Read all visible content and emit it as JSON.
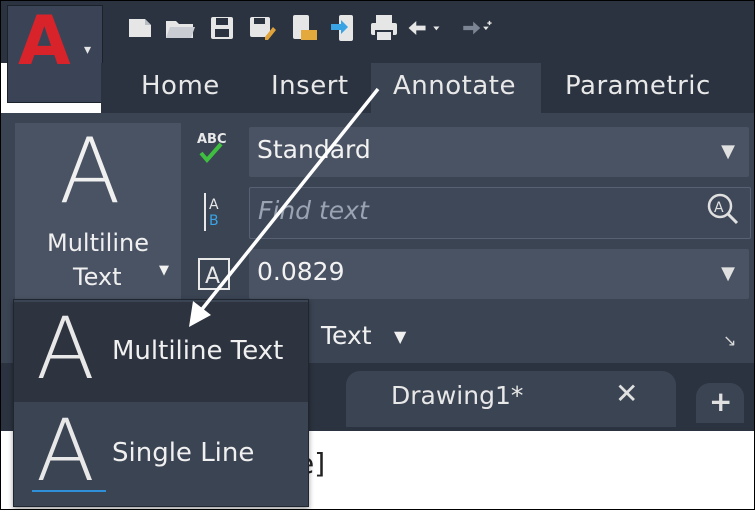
{
  "app": {
    "logo_letter": "A",
    "brand_color": "#d9232a",
    "menu_caret": "▾"
  },
  "quick_access": [
    "new-icon",
    "open-icon",
    "save-icon",
    "save-as-icon",
    "open-web-icon",
    "export-icon",
    "plot-icon",
    "undo-icon",
    "redo-icon"
  ],
  "ribbon_tabs": [
    {
      "label": "Home"
    },
    {
      "label": "Insert"
    },
    {
      "label": "Annotate",
      "active": true
    },
    {
      "label": "Parametric"
    }
  ],
  "text_panel": {
    "multiline_letter": "A",
    "multiline_label_1": "Multiline",
    "multiline_label_2": "Text",
    "style_value": "Standard",
    "spell_icon_text": "ABC",
    "find_placeholder": "Find text",
    "find_icon_text": "A B",
    "height_value": "0.0829",
    "height_icon_text": "A",
    "panel_label": "Text"
  },
  "file_tabs": {
    "drawing_label": "Drawing1*",
    "close_glyph": "✕",
    "new_tab_glyph": "+"
  },
  "status": {
    "bracket_text": "e]"
  },
  "flyout": {
    "items": [
      {
        "letter": "A",
        "label": "Multiline Text",
        "selected": true
      },
      {
        "letter": "A",
        "label": "Single Line",
        "selected": false
      }
    ]
  },
  "colors": {
    "dark_bg": "#2b3340",
    "panel_bg": "#3b4453",
    "combo_bg": "#4a5363",
    "accent_blue": "#2f8fd8",
    "check_green": "#3fbf3f"
  }
}
